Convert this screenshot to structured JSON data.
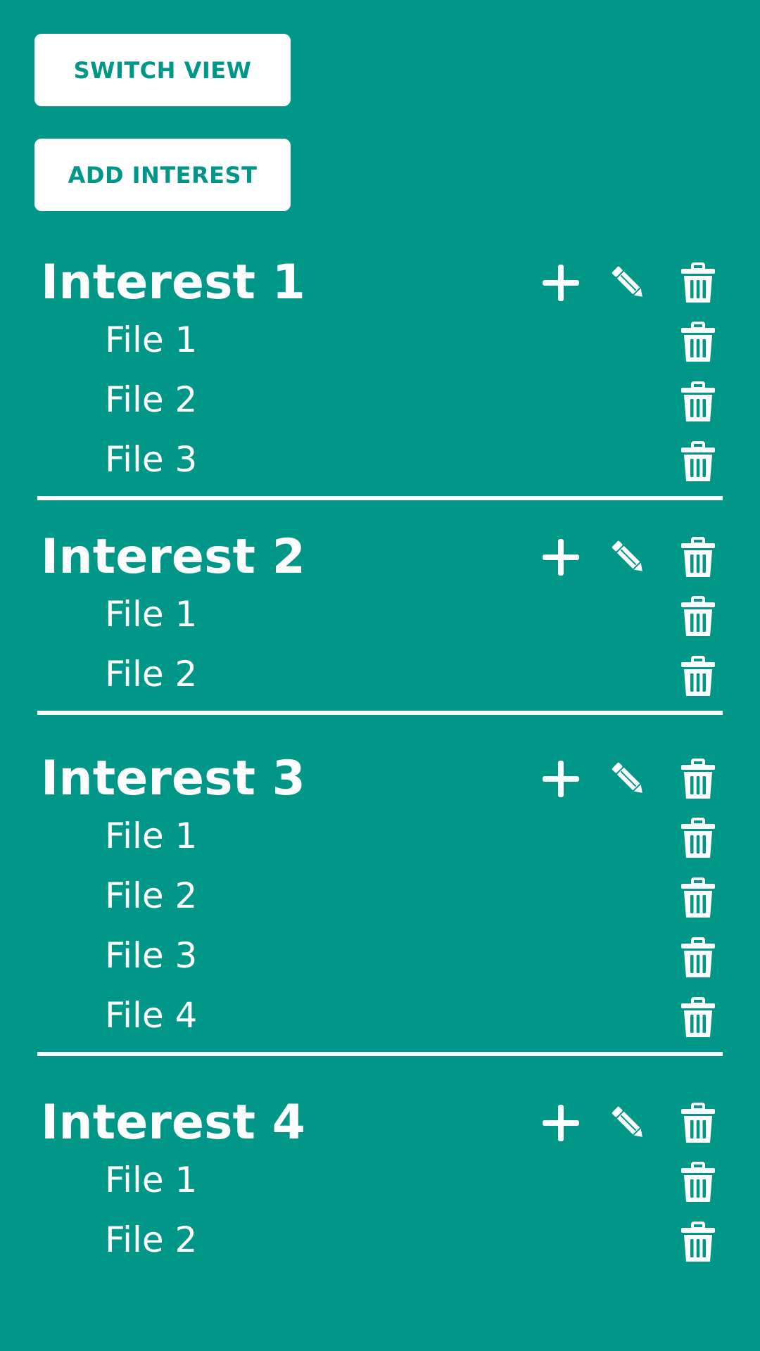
{
  "toolbar": {
    "switch_view_label": "SWITCH VIEW",
    "add_interest_label": "ADD INTEREST"
  },
  "colors": {
    "background": "#009688",
    "foreground": "#ffffff",
    "button_background": "#ffffff",
    "button_text": "#009688"
  },
  "icons": {
    "add": "plus-icon",
    "edit": "pencil-icon",
    "delete": "trash-icon"
  },
  "interests": [
    {
      "title": "Interest 1",
      "files": [
        "File 1",
        "File 2",
        "File 3"
      ]
    },
    {
      "title": "Interest 2",
      "files": [
        "File 1",
        "File 2"
      ]
    },
    {
      "title": "Interest 3",
      "files": [
        "File 1",
        "File 2",
        "File 3",
        "File 4"
      ]
    },
    {
      "title": "Interest 4",
      "files": [
        "File 1",
        "File 2"
      ]
    }
  ]
}
